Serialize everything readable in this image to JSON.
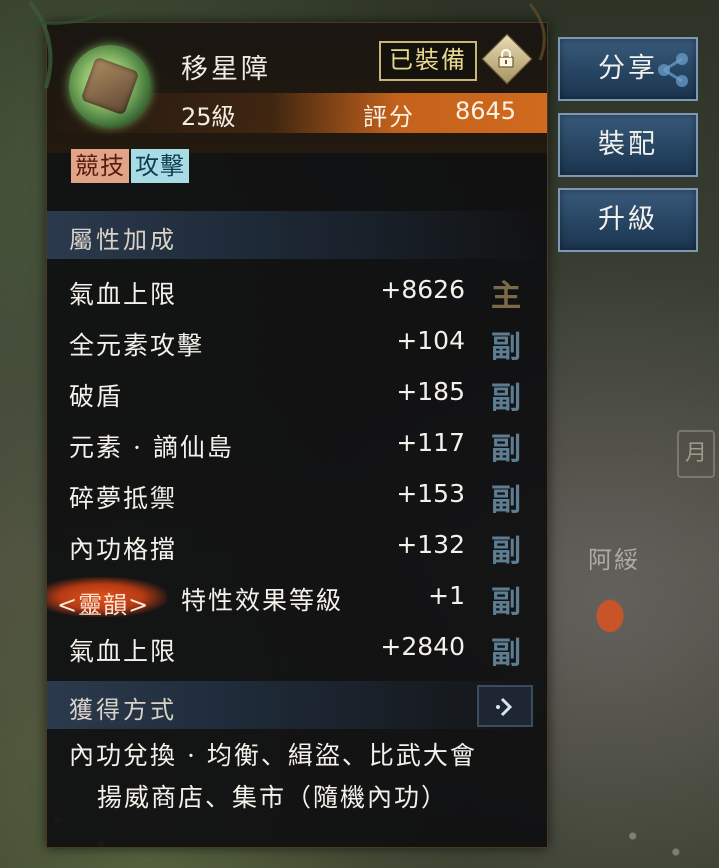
{
  "item": {
    "name": "移星障",
    "level": "25級",
    "equipped_label": "已裝備",
    "score_label": "評分",
    "score_value": "8645",
    "tags": [
      "競技",
      "攻擊"
    ]
  },
  "attributes": {
    "title": "屬性加成",
    "rows": [
      {
        "name": "氣血上限",
        "value": "+8626",
        "type": "主"
      },
      {
        "name": "全元素攻擊",
        "value": "+104",
        "type": "副"
      },
      {
        "name": "破盾",
        "value": "+185",
        "type": "副"
      },
      {
        "name": "元素 · 謫仙島",
        "value": "+117",
        "type": "副"
      },
      {
        "name": "碎夢抵禦",
        "value": "+153",
        "type": "副"
      },
      {
        "name": "內功格擋",
        "value": "+132",
        "type": "副"
      },
      {
        "prefix": "<靈韻>",
        "name": "特性效果等級",
        "value": "+1",
        "type": "副"
      },
      {
        "name": "氣血上限",
        "value": "+2840",
        "type": "副"
      }
    ]
  },
  "source": {
    "title": "獲得方式",
    "line1": "內功兌換 · 均衡、緝盜、比武大會",
    "line2": "揚威商店、集市（隨機內功）"
  },
  "actions": {
    "share": "分享",
    "equip": "裝配",
    "upgrade": "升級"
  },
  "scene": {
    "npc_name": "阿綏",
    "sign": "月"
  },
  "colors": {
    "accent_orange": "#d06a1e",
    "button_blue": "#264562",
    "main_type": "#7a6a48",
    "sub_type": "#5d7d92"
  },
  "icons": {
    "lock": "lock-icon",
    "share": "share-icon",
    "go": "chevron-right-icon"
  }
}
